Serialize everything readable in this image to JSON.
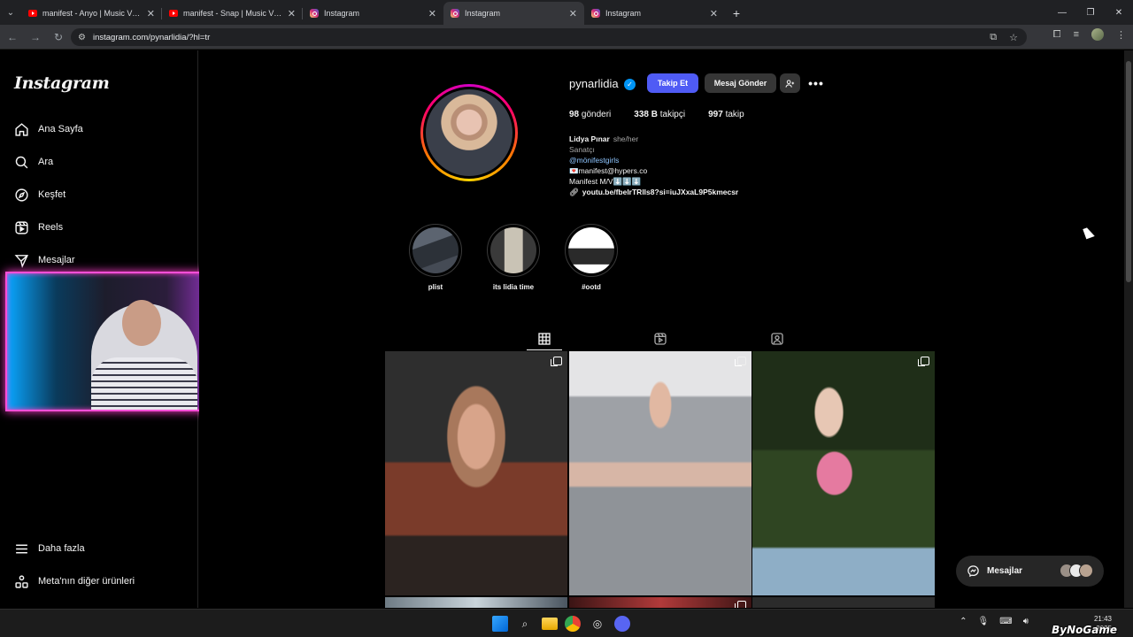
{
  "browser": {
    "tabs": [
      {
        "title": "manifest - Anyo | Music Video",
        "favicon": "youtube-icon",
        "active": false
      },
      {
        "title": "manifest - Snap | Music Video",
        "favicon": "youtube-icon",
        "active": false
      },
      {
        "title": "Instagram",
        "favicon": "instagram-icon",
        "active": false
      },
      {
        "title": "Instagram",
        "favicon": "instagram-icon",
        "active": true
      },
      {
        "title": "Instagram",
        "favicon": "instagram-icon",
        "active": false
      }
    ],
    "url": "instagram.com/pynarlidia/?hl=tr"
  },
  "sidebar": {
    "logo": "Instagram",
    "items": [
      {
        "label": "Ana Sayfa",
        "icon": "home-icon"
      },
      {
        "label": "Ara",
        "icon": "search-icon"
      },
      {
        "label": "Keşfet",
        "icon": "compass-icon"
      },
      {
        "label": "Reels",
        "icon": "reels-icon"
      },
      {
        "label": "Mesajlar",
        "icon": "messages-icon"
      }
    ],
    "bottom_items": [
      {
        "label": "Daha fazla",
        "icon": "menu-icon"
      },
      {
        "label": "Meta'nın diğer ürünleri",
        "icon": "meta-products-icon"
      }
    ]
  },
  "profile": {
    "username": "pynarlidia",
    "verified": true,
    "follow_label": "Takip Et",
    "message_label": "Mesaj Gönder",
    "stats": {
      "posts_count": "98",
      "posts_label": "gönderi",
      "followers_count": "338 B",
      "followers_label": "takipçi",
      "following_count": "997",
      "following_label": "takip"
    },
    "bio": {
      "name": "Lidya Pınar",
      "pronouns": "she/her",
      "category": "Sanatçı",
      "mention": "@mönifestgirls",
      "email_line": "💌manifest@hypers.co",
      "line2": "Manifest M/V⬇️⬇️⬇️",
      "link": "youtu.be/fbelrTRlls8?si=iuJXxaL9P5kmecsr"
    },
    "highlights": [
      {
        "label": "plist"
      },
      {
        "label": "its lidia time"
      },
      {
        "label": "#ootd"
      }
    ]
  },
  "messages_pill": {
    "label": "Mesajlar"
  },
  "taskbar": {
    "time": "21:43",
    "date": "…2025"
  },
  "watermark": "ByNoGame",
  "colors": {
    "accent_button": "#4f5bf5",
    "verified_blue": "#0095f6",
    "webcam_border": "#ff4fd8"
  }
}
